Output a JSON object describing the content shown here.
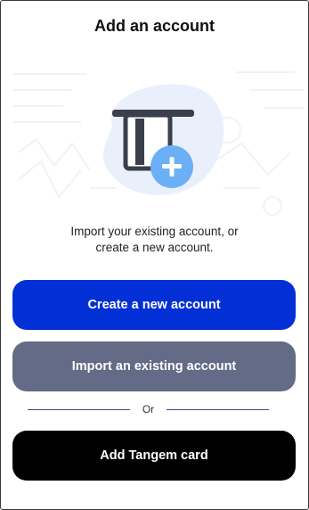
{
  "header": {
    "title": "Add an account"
  },
  "illustration": {
    "card_icon": "card-slot-icon",
    "plus_icon": "plus-icon",
    "accent_color": "#6bb0f7"
  },
  "description": {
    "line1": "Import your existing account, or",
    "line2": "create a new account."
  },
  "actions": {
    "create_label": "Create a new account",
    "import_label": "Import an existing account",
    "divider_label": "Or",
    "tangem_label": "Add Tangem card"
  },
  "colors": {
    "create_button": "#0330d6",
    "import_button": "#636b86",
    "tangem_button": "#000000"
  }
}
